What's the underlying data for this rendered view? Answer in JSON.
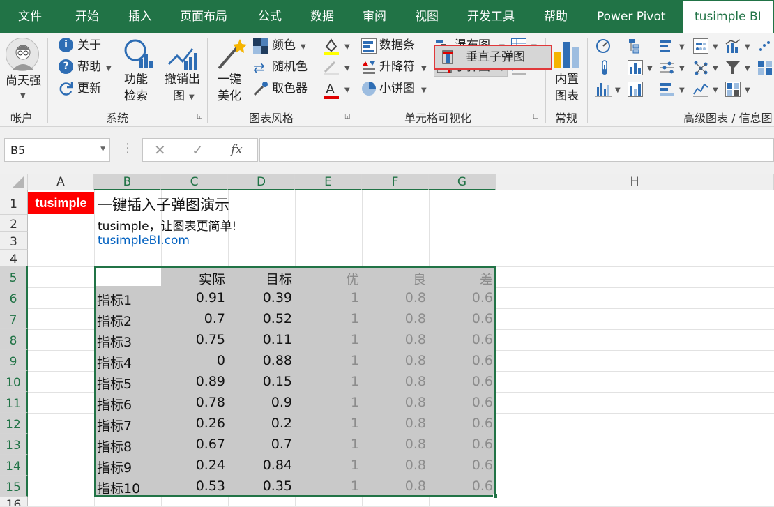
{
  "tabs": [
    "文件",
    "开始",
    "插入",
    "页面布局",
    "公式",
    "数据",
    "审阅",
    "视图",
    "开发工具",
    "帮助",
    "Power Pivot",
    "tusimple BI"
  ],
  "ribbon": {
    "account": {
      "name": "尚天强",
      "group": "帐户"
    },
    "system": {
      "about": "关于",
      "help": "帮助",
      "update": "更新",
      "search_l1": "功能",
      "search_l2": "检索",
      "undo_l1": "撤销出",
      "undo_l2": "图",
      "group": "系统"
    },
    "style": {
      "beautify_l1": "一键",
      "beautify_l2": "美化",
      "color": "颜色",
      "random_color": "随机色",
      "picker": "取色器",
      "group": "图表风格"
    },
    "cellviz": {
      "databar": "数据条",
      "updown": "升降符",
      "pie": "小饼图",
      "waterfall": "瀑布图",
      "bullet": "子弹图",
      "group": "单元格可视化"
    },
    "builtin": {
      "l1": "内置",
      "l2": "图表",
      "group": "常规"
    },
    "advanced": {
      "group": "高级图表 / 信息图"
    },
    "dropdown_item": "垂直子弹图"
  },
  "formula_bar": {
    "namebox": "B5",
    "cancel": "✕",
    "enter": "✓",
    "fx": "fx",
    "formula": ""
  },
  "columns": [
    "A",
    "B",
    "C",
    "D",
    "E",
    "F",
    "G",
    "H"
  ],
  "rows": [
    "1",
    "2",
    "3",
    "4",
    "5",
    "6",
    "7",
    "8",
    "9",
    "10",
    "11",
    "12",
    "13",
    "14",
    "15",
    "16"
  ],
  "sheet": {
    "badge": "tusimple",
    "title": "一键插入子弹图演示",
    "subtitle": "tusimple，让图表更简单!",
    "link": "tusimpleBI.com",
    "table": {
      "headers": [
        "实际",
        "目标",
        "优",
        "良",
        "差"
      ],
      "rows": [
        {
          "label": "指标1",
          "actual": "0.91",
          "target": "0.39",
          "good": "1",
          "fair": "0.8",
          "poor": "0.6"
        },
        {
          "label": "指标2",
          "actual": "0.7",
          "target": "0.52",
          "good": "1",
          "fair": "0.8",
          "poor": "0.6"
        },
        {
          "label": "指标3",
          "actual": "0.75",
          "target": "0.11",
          "good": "1",
          "fair": "0.8",
          "poor": "0.6"
        },
        {
          "label": "指标4",
          "actual": "0",
          "target": "0.88",
          "good": "1",
          "fair": "0.8",
          "poor": "0.6"
        },
        {
          "label": "指标5",
          "actual": "0.89",
          "target": "0.15",
          "good": "1",
          "fair": "0.8",
          "poor": "0.6"
        },
        {
          "label": "指标6",
          "actual": "0.78",
          "target": "0.9",
          "good": "1",
          "fair": "0.8",
          "poor": "0.6"
        },
        {
          "label": "指标7",
          "actual": "0.26",
          "target": "0.2",
          "good": "1",
          "fair": "0.8",
          "poor": "0.6"
        },
        {
          "label": "指标8",
          "actual": "0.67",
          "target": "0.7",
          "good": "1",
          "fair": "0.8",
          "poor": "0.6"
        },
        {
          "label": "指标9",
          "actual": "0.24",
          "target": "0.84",
          "good": "1",
          "fair": "0.8",
          "poor": "0.6"
        },
        {
          "label": "指标10",
          "actual": "0.53",
          "target": "0.35",
          "good": "1",
          "fair": "0.8",
          "poor": "0.6"
        }
      ]
    }
  },
  "colors": {
    "excel_green": "#217346",
    "badge_red": "#ff0000",
    "link_blue": "#0563c1",
    "table_fill": "#c9c9c9",
    "dropdown_border": "#e0393b"
  }
}
